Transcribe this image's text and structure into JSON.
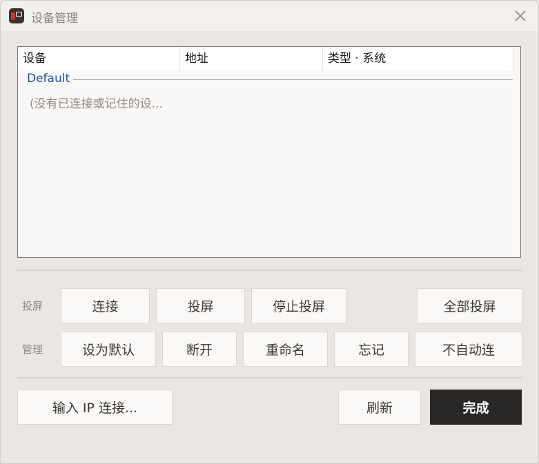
{
  "window": {
    "title": "设备管理"
  },
  "device_list": {
    "columns": [
      "设备",
      "地址",
      "类型 · 系统"
    ],
    "group_name": "Default",
    "empty_text": "(没有已连接或记住的设..."
  },
  "cast_row": {
    "label": "投屏",
    "buttons": [
      "连接",
      "投屏",
      "停止投屏",
      "全部投屏"
    ]
  },
  "manage_row": {
    "label": "管理",
    "buttons": [
      "设为默认",
      "断开",
      "重命名",
      "忘记",
      "不自动连"
    ]
  },
  "footer": {
    "enter_ip_label": "输入 IP 连接...",
    "refresh_label": "刷新",
    "done_label": "完成"
  }
}
